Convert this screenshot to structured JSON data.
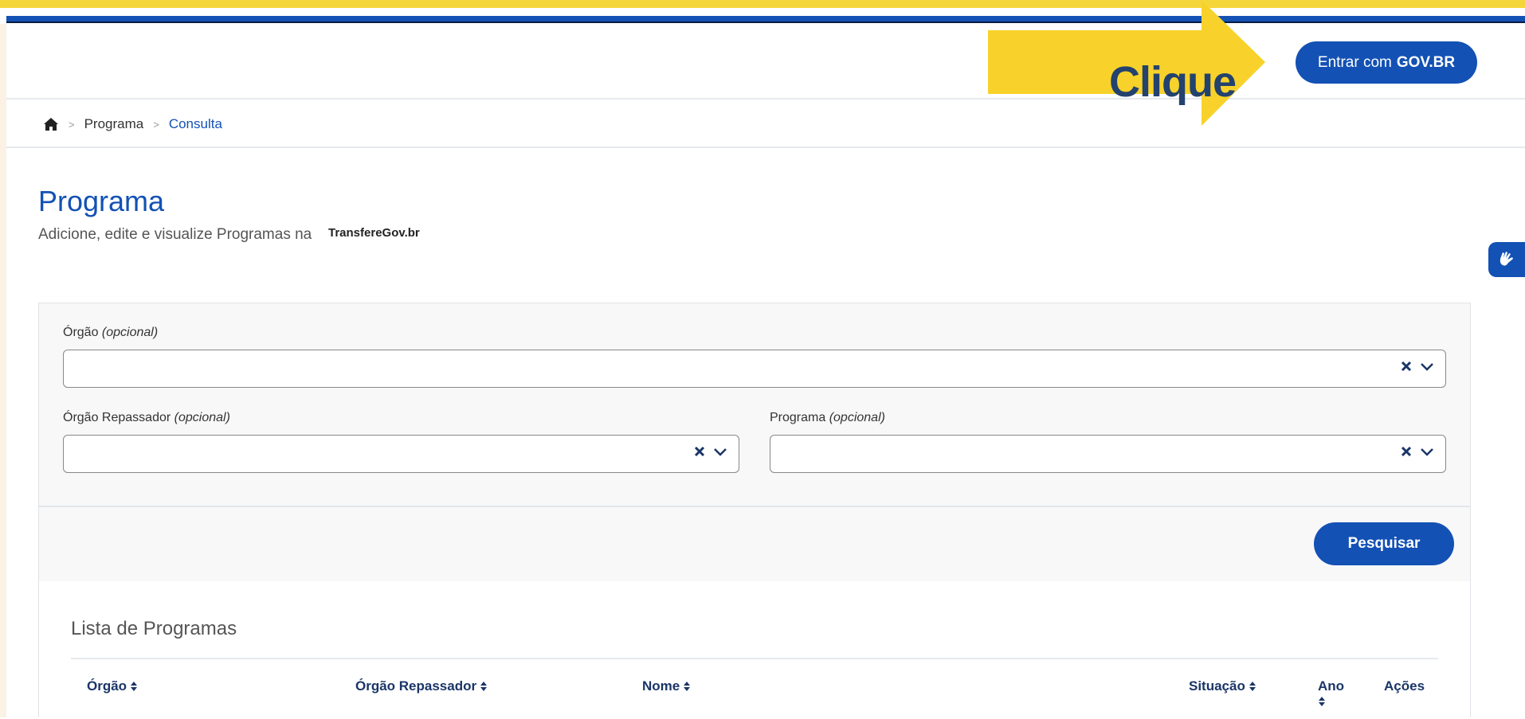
{
  "header": {
    "login_prefix": "Entrar com",
    "login_brand": "GOV.BR",
    "callout_text": "Clique"
  },
  "breadcrumb": {
    "items": [
      "Programa",
      "Consulta"
    ]
  },
  "page": {
    "title": "Programa",
    "subtitle": "Adicione, edite e visualize Programas na",
    "brand": "TransfereGov.br"
  },
  "filters": {
    "orgao": {
      "label": "Órgão",
      "optional": "(opcional)",
      "value": ""
    },
    "orgao_repassador": {
      "label": "Órgão Repassador",
      "optional": "(opcional)",
      "value": ""
    },
    "programa": {
      "label": "Programa",
      "optional": "(opcional)",
      "value": ""
    },
    "search_label": "Pesquisar"
  },
  "results": {
    "title": "Lista de Programas",
    "columns": [
      "Órgão",
      "Órgão Repassador",
      "Nome",
      "Situação",
      "Ano",
      "Ações"
    ]
  },
  "colors": {
    "primary": "#1351b4",
    "accent_yellow": "#f5d63a",
    "callout_text": "#23426e"
  }
}
